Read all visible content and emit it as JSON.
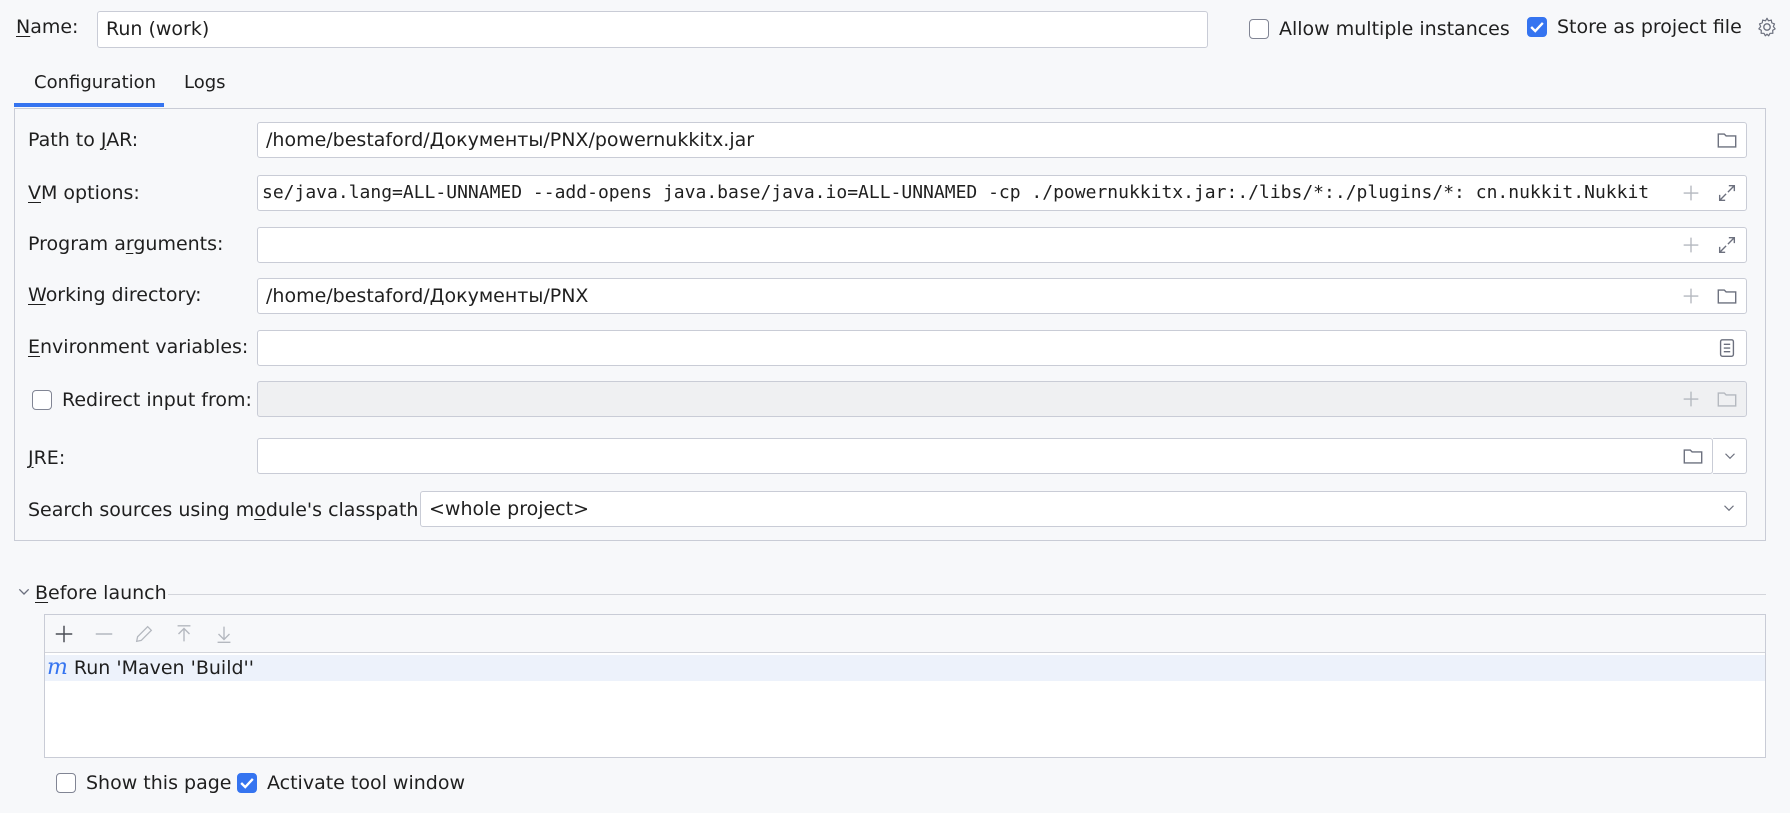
{
  "header": {
    "name_label": "Name:",
    "name_value": "Run (work)",
    "allow_multiple": {
      "label": "Allow multiple instances",
      "checked": false
    },
    "store_project": {
      "label": "Store as project file",
      "checked": true
    }
  },
  "tabs": [
    {
      "label": "Configuration",
      "active": true
    },
    {
      "label": "Logs",
      "active": false
    }
  ],
  "config": {
    "path_to_jar": {
      "label": "Path to JAR:",
      "value": "/home/bestaford/Документы/PNX/powernukkitx.jar"
    },
    "vm_options": {
      "label": "VM options:",
      "value": "se/java.lang=ALL-UNNAMED --add-opens java.base/java.io=ALL-UNNAMED -cp ./powernukkitx.jar:./libs/*:./plugins/*: cn.nukkit.Nukkit"
    },
    "program_arguments": {
      "label": "Program arguments:",
      "value": ""
    },
    "working_directory": {
      "label": "Working directory:",
      "value": "/home/bestaford/Документы/PNX"
    },
    "environment_variables": {
      "label": "Environment variables:",
      "value": ""
    },
    "redirect_input": {
      "label": "Redirect input from:",
      "checked": false,
      "value": ""
    },
    "jre": {
      "label": "JRE:",
      "value": ""
    },
    "search_sources": {
      "label": "Search sources using module's classpath:",
      "value": "<whole project>"
    }
  },
  "before_launch": {
    "title": "Before launch",
    "toolbar": [
      "add-icon",
      "remove-icon",
      "edit-icon",
      "move-up-icon",
      "move-down-icon"
    ],
    "items": [
      {
        "icon": "maven-icon",
        "label": "Run 'Maven 'Build''"
      }
    ],
    "show_this_page": {
      "label": "Show this page",
      "checked": false
    },
    "activate_tool_window": {
      "label": "Activate tool window",
      "checked": true
    }
  },
  "colors": {
    "accent": "#3574f0",
    "background": "#f7f8fa",
    "border": "#c9ccd6"
  }
}
